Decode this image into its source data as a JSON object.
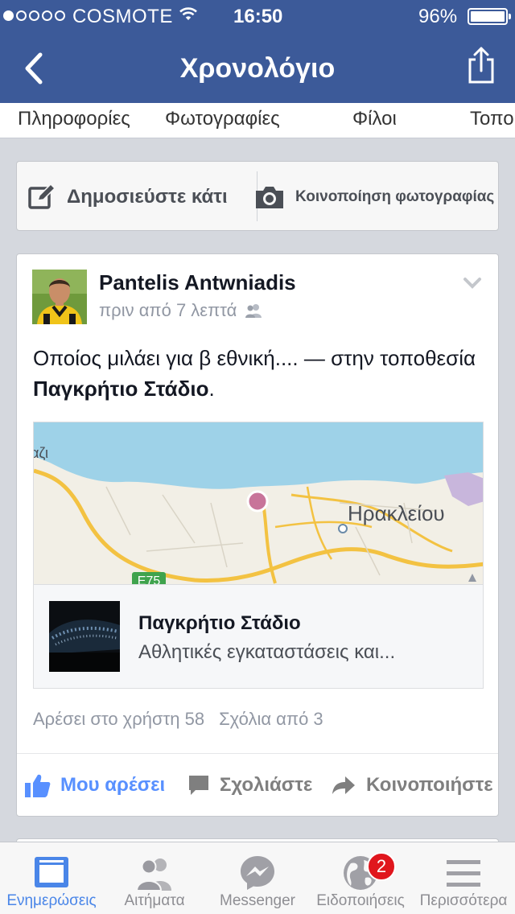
{
  "status_bar": {
    "carrier": "COSMOTE",
    "time": "16:50",
    "battery": "96%",
    "signal_bars_filled": 1,
    "signal_bars_total": 5
  },
  "nav": {
    "title": "Χρονολόγιο",
    "back_icon": "chevron-left-icon",
    "share_icon": "share-icon"
  },
  "tabs": [
    "Πληροφορίες",
    "Φωτογραφίες",
    "Φίλοι",
    "Τοπο"
  ],
  "composer": {
    "post_label": "Δημοσιεύστε κάτι",
    "photo_label": "Κοινοποίηση φωτογραφίας"
  },
  "story": {
    "author": "Pantelis Antwniadis",
    "time": "πριν από 7 λεπτά",
    "message_text": "Οποίος μιλάει για β εθνική.... — στην τοποθεσία ",
    "message_place": "Παγκρήτιο Στάδιο",
    "message_end": ".",
    "map": {
      "city_label": "Ηρακλείου",
      "road_label": "E75",
      "partial_label": "αζι"
    },
    "place": {
      "name": "Παγκρήτιο Στάδιο",
      "category": "Αθλητικές εγκαταστάσεις και..."
    },
    "likes": "Αρέσει στο χρήστη 58",
    "comments": "Σχόλια από 3",
    "actions": {
      "like": "Μου αρέσει",
      "comment": "Σχολιάστε",
      "share": "Κοινοποιήστε"
    }
  },
  "tabbar": [
    {
      "label": "Ενημερώσεις",
      "icon": "news-feed-icon",
      "active": true
    },
    {
      "label": "Αιτήματα",
      "icon": "friend-requests-icon",
      "active": false
    },
    {
      "label": "Messenger",
      "icon": "messenger-icon",
      "active": false
    },
    {
      "label": "Ειδοποιήσεις",
      "icon": "globe-icon",
      "active": false,
      "badge": "2"
    },
    {
      "label": "Περισσότερα",
      "icon": "menu-icon",
      "active": false
    }
  ],
  "colors": {
    "brand": "#3c5a99",
    "like_blue": "#5890ff",
    "active_tab": "#4a86e8",
    "badge": "#e0161d",
    "background": "#d5d8de"
  }
}
